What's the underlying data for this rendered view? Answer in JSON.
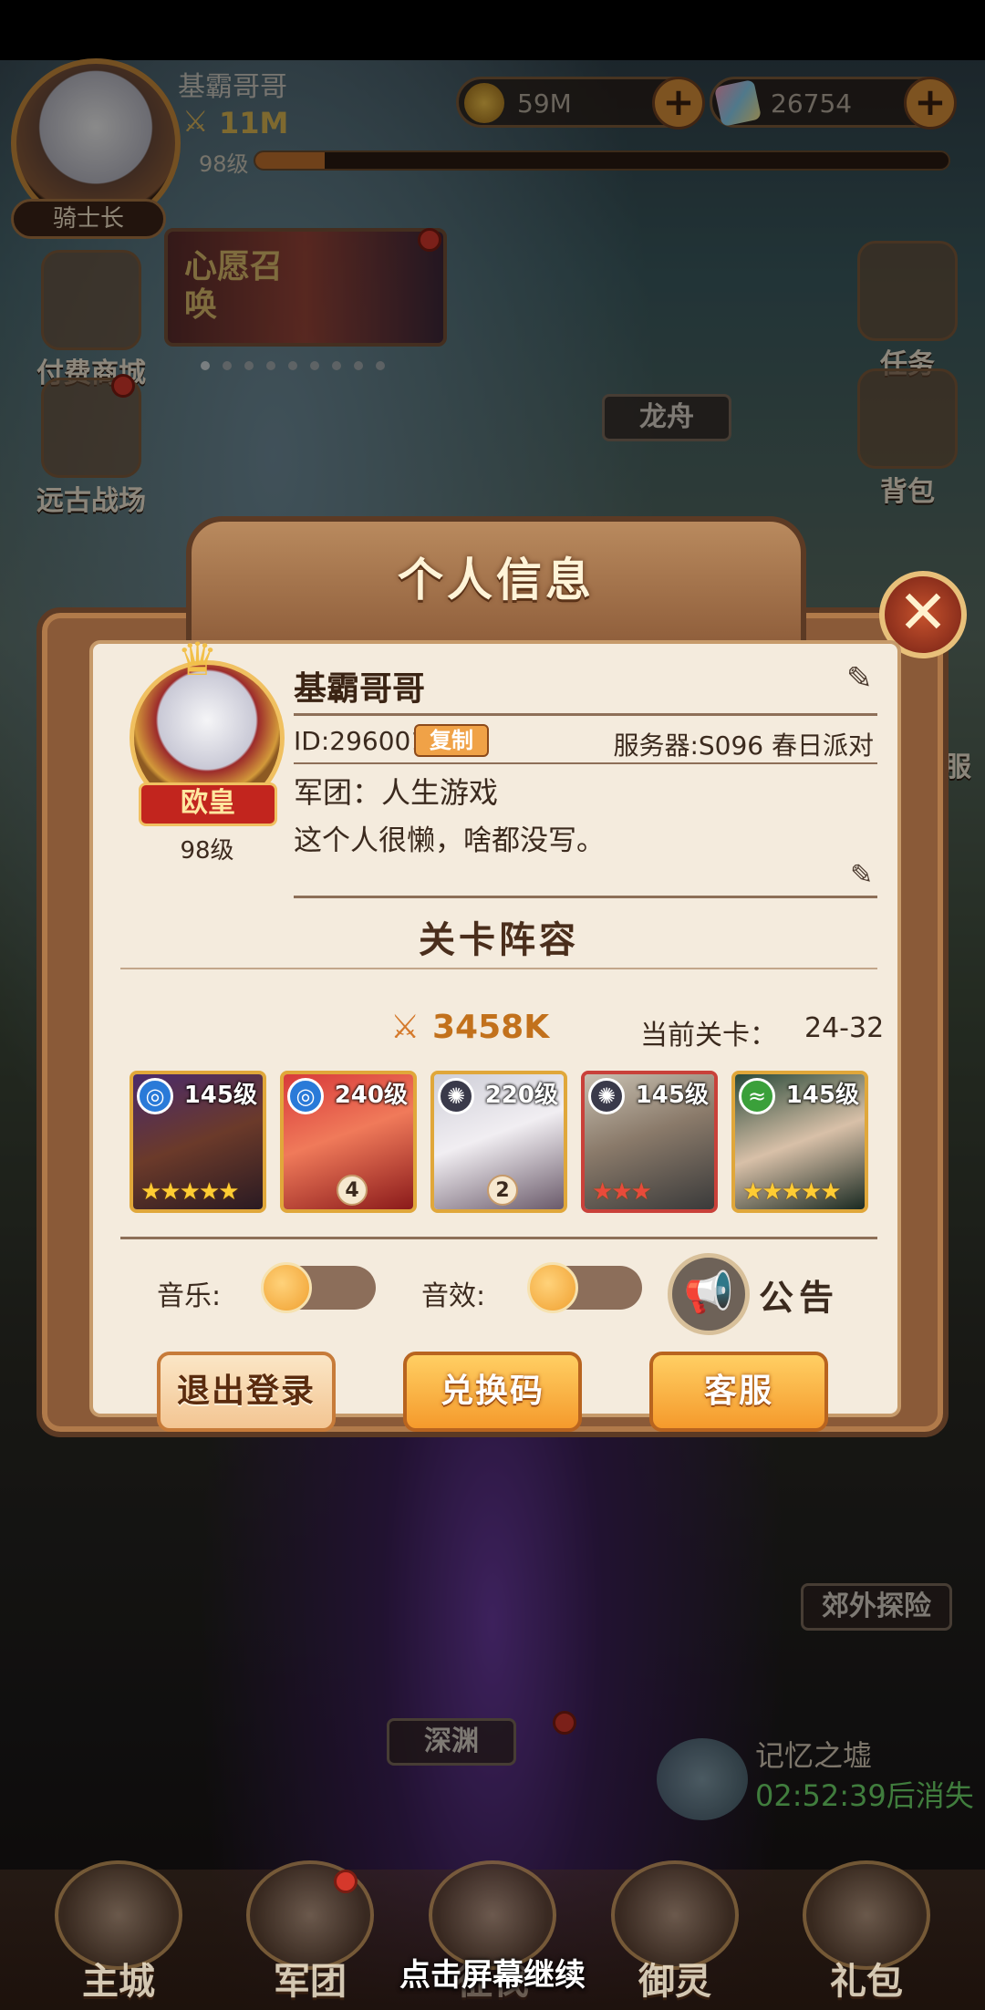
{
  "hud": {
    "player_name": "基霸哥哥",
    "power": "11M",
    "level": "98级",
    "exp_progress": 0.1,
    "title_badge": "骑士长",
    "gold": "59M",
    "diamonds": "26754"
  },
  "side_left": [
    {
      "label": "付费商城"
    },
    {
      "label": "远古战场"
    }
  ],
  "side_right": [
    {
      "label": "任务"
    },
    {
      "label": "背包"
    },
    {
      "label": "服"
    }
  ],
  "banner": {
    "text": "心愿召唤"
  },
  "map_labels": {
    "dragon_boat": "龙舟",
    "outskirts": "郊外探险",
    "abyss": "深渊"
  },
  "memory": {
    "title": "记忆之墟",
    "countdown": "02:52:39后消失"
  },
  "panel": {
    "title": "个人信息",
    "name": "基霸哥哥",
    "rank_title": "欧皇",
    "level": "98级",
    "id_text": "ID:29600100",
    "copy_label": "复制",
    "server": "服务器:S096 春日派对",
    "guild": "军团：人生游戏",
    "signature": "这个人很懒，啥都没写。",
    "lineup_title": "关卡阵容",
    "power": "3458K",
    "stage_label": "当前关卡：",
    "stage_value": "24-32",
    "heroes": [
      {
        "level": "145级",
        "stars": "★★★★★",
        "element": "water",
        "badge": ""
      },
      {
        "level": "240级",
        "stars": "",
        "element": "water",
        "badge": "4"
      },
      {
        "level": "220级",
        "stars": "",
        "element": "dark",
        "badge": "2"
      },
      {
        "level": "145级",
        "stars": "★★★",
        "element": "dark",
        "badge": ""
      },
      {
        "level": "145级",
        "stars": "★★★★★",
        "element": "wind",
        "badge": ""
      }
    ],
    "music_label": "音乐:",
    "sfx_label": "音效:",
    "notice_label": "公告",
    "logout_label": "退出登录",
    "redeem_label": "兑换码",
    "service_label": "客服"
  },
  "bottom_nav": [
    {
      "label": "主城"
    },
    {
      "label": "军团"
    },
    {
      "label": "征伐"
    },
    {
      "label": "御灵"
    },
    {
      "label": "礼包"
    }
  ],
  "continue_hint": "点击屏幕继续",
  "colors": {
    "accent_orange": "#f59a2c",
    "panel_bg": "#f4ebdd",
    "frame_brown": "#8a5a38",
    "close_red": "#c6522d",
    "countdown_green": "#6fd86a"
  }
}
